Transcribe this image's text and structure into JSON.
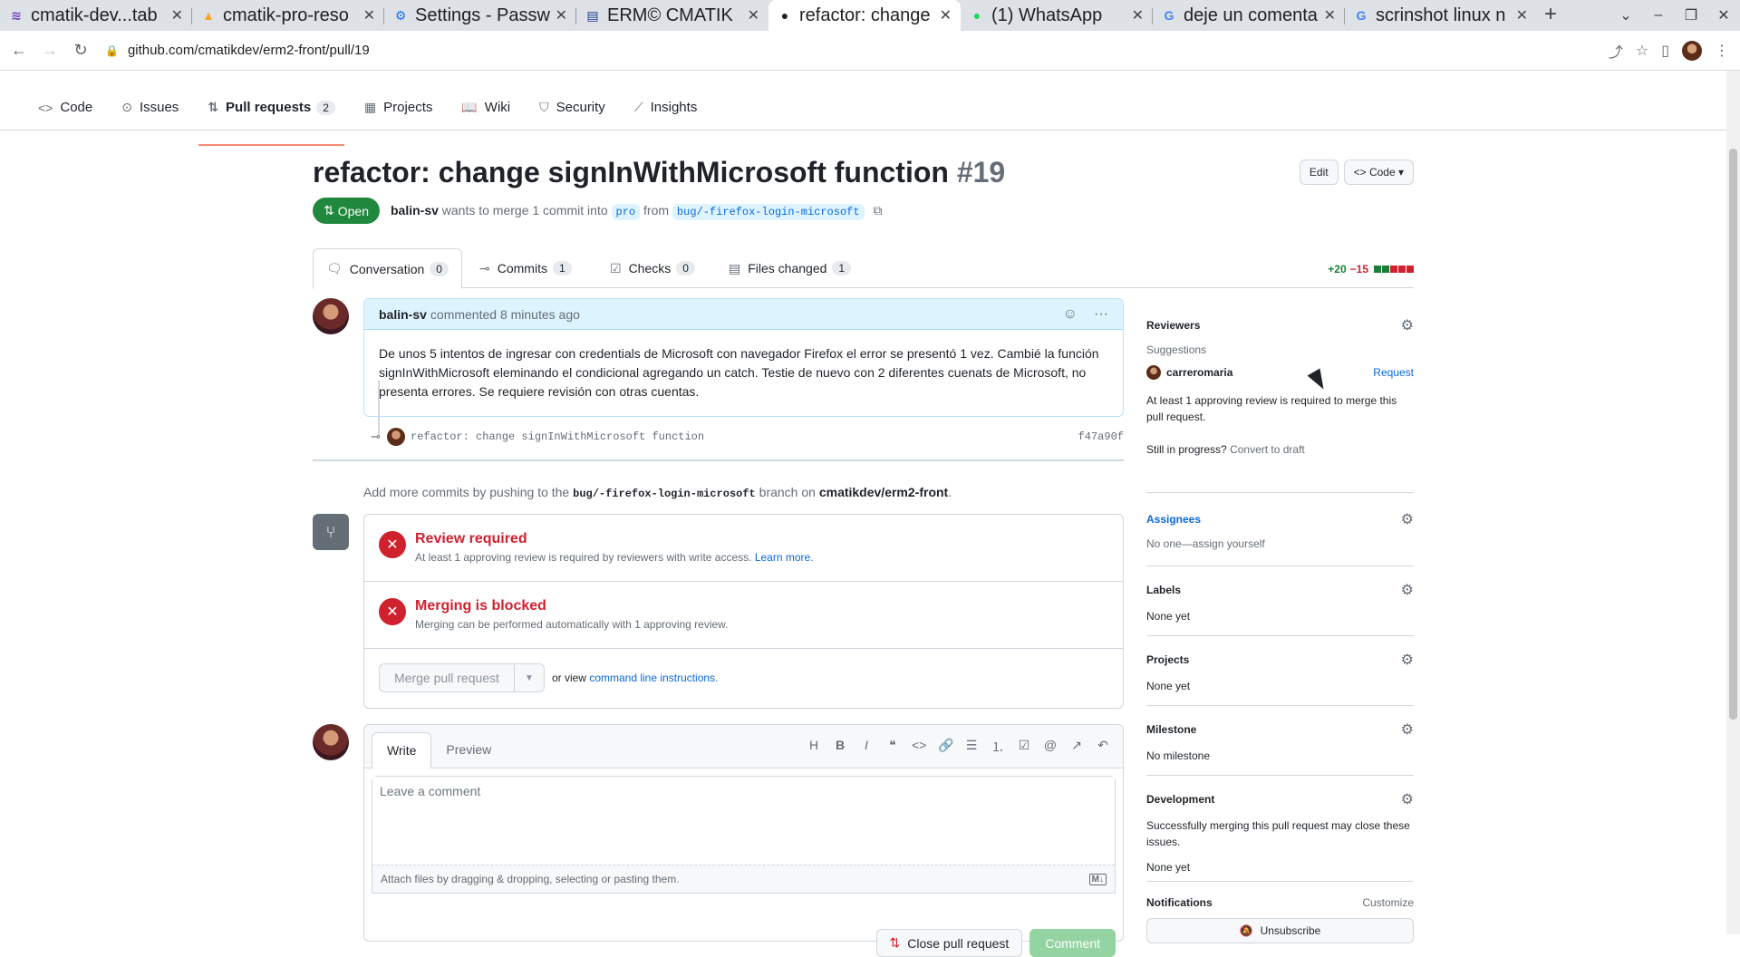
{
  "browser": {
    "tabs": [
      {
        "icon": "stack-icon",
        "title": "cmatik-dev...tab",
        "active": false
      },
      {
        "icon": "firebase-icon",
        "title": "cmatik-pro-reso",
        "active": false
      },
      {
        "icon": "gear-icon",
        "title": "Settings - Passw",
        "active": false
      },
      {
        "icon": "doc-icon",
        "title": "ERM© CMATIK",
        "active": false
      },
      {
        "icon": "github-icon",
        "title": "refactor: change",
        "active": true
      },
      {
        "icon": "whatsapp-icon",
        "title": "(1) WhatsApp",
        "active": false
      },
      {
        "icon": "google-icon",
        "title": "deje un comenta",
        "active": false
      },
      {
        "icon": "google-icon",
        "title": "scrinshot linux n",
        "active": false
      }
    ],
    "url": "github.com/cmatikdev/erm2-front/pull/19"
  },
  "repo_nav": {
    "items": [
      {
        "icon": "code-icon",
        "label": "Code"
      },
      {
        "icon": "issue-icon",
        "label": "Issues"
      },
      {
        "icon": "pr-icon",
        "label": "Pull requests",
        "count": "2",
        "selected": true
      },
      {
        "icon": "table-icon",
        "label": "Projects"
      },
      {
        "icon": "book-icon",
        "label": "Wiki"
      },
      {
        "icon": "shield-icon",
        "label": "Security"
      },
      {
        "icon": "graph-icon",
        "label": "Insights"
      }
    ]
  },
  "pr": {
    "title": "refactor: change signInWithMicrosoft function",
    "number": "#19",
    "state": "Open",
    "author": "balin-sv",
    "merge_text": "wants to merge 1 commit into",
    "base_branch": "pro",
    "from_text": "from",
    "head_branch": "bug/-firefox-login-microsoft",
    "edit_label": "Edit",
    "code_label": "Code",
    "tabs": [
      {
        "label": "Conversation",
        "count": "0"
      },
      {
        "label": "Commits",
        "count": "1"
      },
      {
        "label": "Checks",
        "count": "0"
      },
      {
        "label": "Files changed",
        "count": "1"
      }
    ],
    "additions": "+20",
    "deletions": "−15",
    "diff_blocks": [
      "#1a7f37",
      "#1a7f37",
      "#cf222e",
      "#cf222e",
      "#cf222e"
    ]
  },
  "comment": {
    "author": "balin-sv",
    "time": "commented 8 minutes ago",
    "body": "De unos 5 intentos de ingresar con credentials de Microsoft con navegador Firefox el error se presentó 1 vez. Cambié la función signInWithMicrosoft eleminando el condicional agregando un catch. Testie de nuevo con 2 diferentes cuenats de Microsoft, no presenta errores. Se requiere revisión con otras cuentas."
  },
  "commit": {
    "message": "refactor: change signInWithMicrosoft function",
    "sha": "f47a90f"
  },
  "hint": {
    "prefix": "Add more commits by pushing to the",
    "branch": "bug/-firefox-login-microsoft",
    "middle": "branch on",
    "repo": "cmatikdev/erm2-front",
    "suffix": "."
  },
  "merge": {
    "review_title": "Review required",
    "review_text": "At least 1 approving review is required by reviewers with write access.",
    "learn_more": "Learn more.",
    "blocked_title": "Merging is blocked",
    "blocked_text": "Merging can be performed automatically with 1 approving review.",
    "merge_button": "Merge pull request",
    "or_view": "or view",
    "cli_link": "command line instructions."
  },
  "write": {
    "tab_write": "Write",
    "tab_preview": "Preview",
    "placeholder": "Leave a comment",
    "attach": "Attach files by dragging & dropping, selecting or pasting them.",
    "close_button": "Close pull request",
    "comment_button": "Comment"
  },
  "sidebar": {
    "reviewers": {
      "title": "Reviewers",
      "suggestions": "Suggestions",
      "user": "carreromaria",
      "request": "Request",
      "note": "At least 1 approving review is required to merge this pull request.",
      "progress": "Still in progress?",
      "draft": "Convert to draft"
    },
    "assignees": {
      "title": "Assignees",
      "text": "No one—",
      "link": "assign yourself"
    },
    "labels": {
      "title": "Labels",
      "text": "None yet"
    },
    "projects": {
      "title": "Projects",
      "text": "None yet"
    },
    "milestone": {
      "title": "Milestone",
      "text": "No milestone"
    },
    "development": {
      "title": "Development",
      "text": "Successfully merging this pull request may close these issues.",
      "none": "None yet"
    },
    "notifications": {
      "title": "Notifications",
      "customize": "Customize",
      "unsubscribe": "Unsubscribe"
    }
  }
}
